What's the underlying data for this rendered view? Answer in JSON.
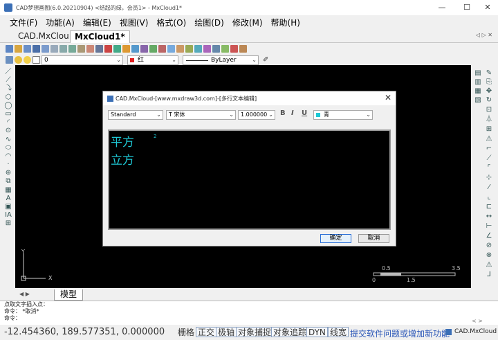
{
  "window": {
    "title": "CAD梦想画图(6.0.20210904) <结起的绿，会员1> - MxCloud1*",
    "minimize": "—",
    "maximize": "☐",
    "close": "✕"
  },
  "menu": [
    "文件(F)",
    "功能(A)",
    "编辑(E)",
    "视图(V)",
    "格式(O)",
    "绘图(D)",
    "修改(M)",
    "帮助(H)"
  ],
  "doc_tabs": {
    "inactive": "CAD.MxCloud",
    "active": "MxCloud1*",
    "nav": "◁ ▷ ✕"
  },
  "layer_bar": {
    "layer_value": "0",
    "color_value": "红",
    "linetype_value": "ByLayer",
    "color_swatch": "#e02020"
  },
  "model_tab": {
    "label": "模型",
    "nav": "◀ ▶"
  },
  "command": {
    "lines": [
      "点取文字插入点：",
      "命令：  *取消*",
      "命令："
    ],
    "scroll": "< >"
  },
  "status": {
    "coords": "-12.454360, 189.577351, 0.000000",
    "toggles": [
      "栅格",
      "正交",
      "极轴",
      "对象捕捉",
      "对象追踪",
      "DYN",
      "线宽"
    ],
    "link": "提交软件问题或增加新功能",
    "brand": "CAD.MxCloud"
  },
  "dialog": {
    "title": "CAD.MxCloud-[www.mxdraw3d.com]-[多行文本编辑]",
    "close": "✕",
    "style": "Standard",
    "font": "宋体",
    "font_prefix": "T",
    "height": "1.000000",
    "bold": "B",
    "italic": "I",
    "underline": "U",
    "color": "青",
    "color_swatch": "#1ec9d6",
    "editor_lines": [
      "平方",
      "立方"
    ],
    "superscript": "2",
    "ok": "确定",
    "cancel": "取消"
  },
  "canvas": {
    "ucs_y": "Y",
    "ucs_x": "X",
    "scale_labels": [
      "0.5",
      "3.5",
      "0",
      "1.5"
    ]
  }
}
